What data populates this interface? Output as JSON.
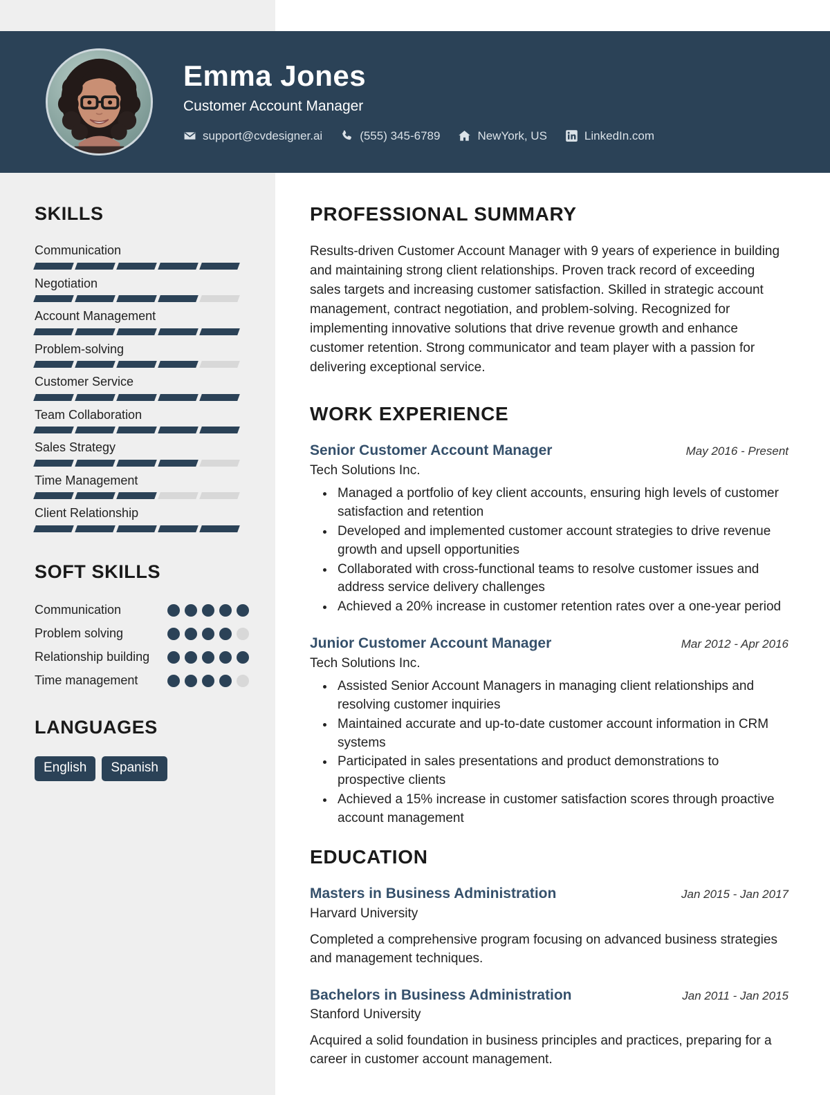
{
  "theme": {
    "navy": "#2b4257",
    "sidebar_bg": "#efefef",
    "title_blue": "#35506b",
    "bar_empty": "#d8d8d8"
  },
  "header": {
    "full_name": "Emma Jones",
    "job_title": "Customer Account Manager",
    "avatar_alt": "profile-photo",
    "contacts": [
      {
        "icon": "email-icon",
        "text": "support@cvdesigner.ai"
      },
      {
        "icon": "phone-icon",
        "text": "(555) 345-6789"
      },
      {
        "icon": "home-icon",
        "text": "NewYork, US"
      },
      {
        "icon": "linkedin-icon",
        "text": "LinkedIn.com"
      }
    ]
  },
  "sidebar": {
    "skills_heading": "SKILLS",
    "skills": [
      {
        "name": "Communication",
        "level": 5,
        "max": 5
      },
      {
        "name": "Negotiation",
        "level": 4,
        "max": 5
      },
      {
        "name": "Account Management",
        "level": 5,
        "max": 5
      },
      {
        "name": "Problem-solving",
        "level": 4,
        "max": 5
      },
      {
        "name": "Customer Service",
        "level": 5,
        "max": 5
      },
      {
        "name": "Team Collaboration",
        "level": 5,
        "max": 5
      },
      {
        "name": "Sales Strategy",
        "level": 4,
        "max": 5
      },
      {
        "name": "Time Management",
        "level": 3,
        "max": 5
      },
      {
        "name": "Client Relationship",
        "level": 5,
        "max": 5
      }
    ],
    "soft_skills_heading": "SOFT SKILLS",
    "soft_skills": [
      {
        "name": "Communication",
        "level": 5,
        "max": 5
      },
      {
        "name": "Problem solving",
        "level": 4,
        "max": 5
      },
      {
        "name": "Relationship building",
        "level": 5,
        "max": 5
      },
      {
        "name": "Time management",
        "level": 4,
        "max": 5
      }
    ],
    "languages_heading": "LANGUAGES",
    "languages": [
      "English",
      "Spanish"
    ]
  },
  "main": {
    "summary_heading": "PROFESSIONAL SUMMARY",
    "summary_text": "Results-driven Customer Account Manager with 9 years of experience in building and maintaining strong client relationships. Proven track record of exceeding sales targets and increasing customer satisfaction. Skilled in strategic account management, contract negotiation, and problem-solving. Recognized for implementing innovative solutions that drive revenue growth and enhance customer retention. Strong communicator and team player with a passion for delivering exceptional service.",
    "experience_heading": "WORK EXPERIENCE",
    "experience": [
      {
        "title": "Senior Customer Account Manager",
        "date": "May 2016 - Present",
        "company": "Tech Solutions Inc.",
        "bullets": [
          "Managed a portfolio of key client accounts, ensuring high levels of customer satisfaction and retention",
          "Developed and implemented customer account strategies to drive revenue growth and upsell opportunities",
          "Collaborated with cross-functional teams to resolve customer issues and address service delivery challenges",
          "Achieved a 20% increase in customer retention rates over a one-year period"
        ]
      },
      {
        "title": "Junior Customer Account Manager",
        "date": "Mar 2012 - Apr 2016",
        "company": "Tech Solutions Inc.",
        "bullets": [
          "Assisted Senior Account Managers in managing client relationships and resolving customer inquiries",
          "Maintained accurate and up-to-date customer account information in CRM systems",
          "Participated in sales presentations and product demonstrations to prospective clients",
          "Achieved a 15% increase in customer satisfaction scores through proactive account management"
        ]
      }
    ],
    "education_heading": "EDUCATION",
    "education": [
      {
        "degree": "Masters in Business Administration",
        "date": "Jan 2015 - Jan 2017",
        "school": "Harvard University",
        "description": "Completed a comprehensive program focusing on advanced business strategies and management techniques."
      },
      {
        "degree": "Bachelors in Business Administration",
        "date": "Jan 2011 - Jan 2015",
        "school": "Stanford University",
        "description": "Acquired a solid foundation in business principles and practices, preparing for a career in customer account management."
      }
    ]
  }
}
